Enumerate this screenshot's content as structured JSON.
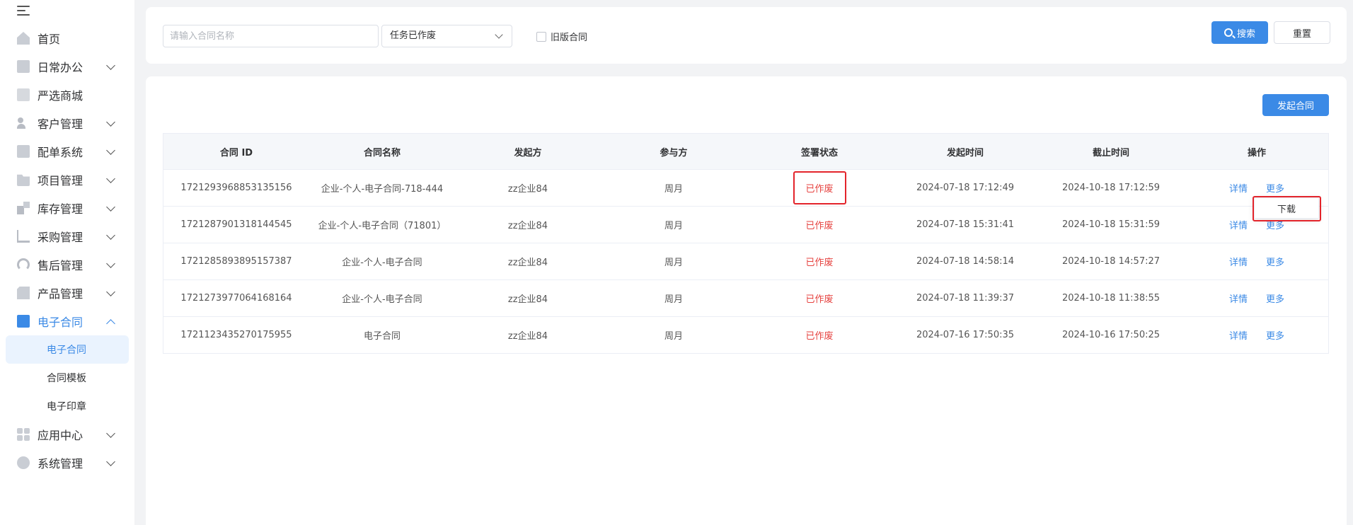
{
  "sidebar": {
    "items": [
      {
        "label": "首页",
        "icon": "home-icon",
        "has_children": false
      },
      {
        "label": "日常办公",
        "icon": "briefcase-icon",
        "has_children": true
      },
      {
        "label": "严选商城",
        "icon": "shop-icon",
        "has_children": false
      },
      {
        "label": "客户管理",
        "icon": "user-icon",
        "has_children": true
      },
      {
        "label": "配单系统",
        "icon": "document-icon",
        "has_children": true
      },
      {
        "label": "项目管理",
        "icon": "folder-icon",
        "has_children": true
      },
      {
        "label": "库存管理",
        "icon": "box-icon",
        "has_children": true
      },
      {
        "label": "采购管理",
        "icon": "cart-icon",
        "has_children": true
      },
      {
        "label": "售后管理",
        "icon": "headset-icon",
        "has_children": true
      },
      {
        "label": "产品管理",
        "icon": "product-icon",
        "has_children": true
      },
      {
        "label": "电子合同",
        "icon": "contract-icon",
        "has_children": true,
        "expanded": true,
        "children": [
          {
            "label": "电子合同",
            "active": true
          },
          {
            "label": "合同模板"
          },
          {
            "label": "电子印章"
          }
        ]
      },
      {
        "label": "应用中心",
        "icon": "app-grid-icon",
        "has_children": true
      },
      {
        "label": "系统管理",
        "icon": "settings-icon",
        "has_children": true
      }
    ]
  },
  "search": {
    "name_placeholder": "请输入合同名称",
    "name_value": "",
    "status_select": "任务已作废",
    "old_contract_label": "旧版合同",
    "old_contract_checked": false,
    "search_button": "搜索",
    "reset_button": "重置"
  },
  "toolbar": {
    "new_contract_button": "发起合同"
  },
  "table": {
    "columns": [
      "合同 ID",
      "合同名称",
      "发起方",
      "参与方",
      "签署状态",
      "发起时间",
      "截止时间",
      "操作"
    ],
    "rows": [
      {
        "id": "1721293968853135156",
        "name": "企业-个人-电子合同-718-444",
        "initiator": "zz企业84",
        "participant": "周月",
        "status": "已作废",
        "start": "2024-07-18 17:12:49",
        "deadline": "2024-10-18 17:12:59"
      },
      {
        "id": "1721287901318144545",
        "name": "企业-个人-电子合同（71801）",
        "initiator": "zz企业84",
        "participant": "周月",
        "status": "已作废",
        "start": "2024-07-18 15:31:41",
        "deadline": "2024-10-18 15:31:59"
      },
      {
        "id": "1721285893895157387",
        "name": "企业-个人-电子合同",
        "initiator": "zz企业84",
        "participant": "周月",
        "status": "已作废",
        "start": "2024-07-18 14:58:14",
        "deadline": "2024-10-18 14:57:27"
      },
      {
        "id": "1721273977064168164",
        "name": "企业-个人-电子合同",
        "initiator": "zz企业84",
        "participant": "周月",
        "status": "已作废",
        "start": "2024-07-18 11:39:37",
        "deadline": "2024-10-18 11:38:55"
      },
      {
        "id": "1721123435270175955",
        "name": "电子合同",
        "initiator": "zz企业84",
        "participant": "周月",
        "status": "已作废",
        "start": "2024-07-16 17:50:35",
        "deadline": "2024-10-16 17:50:25"
      }
    ],
    "actions": {
      "detail": "详情",
      "more": "更多"
    }
  },
  "more_menu": {
    "download": "下载"
  },
  "colors": {
    "primary": "#3b8ae6",
    "status_void": "#e64340",
    "highlight": "#e3242b"
  }
}
